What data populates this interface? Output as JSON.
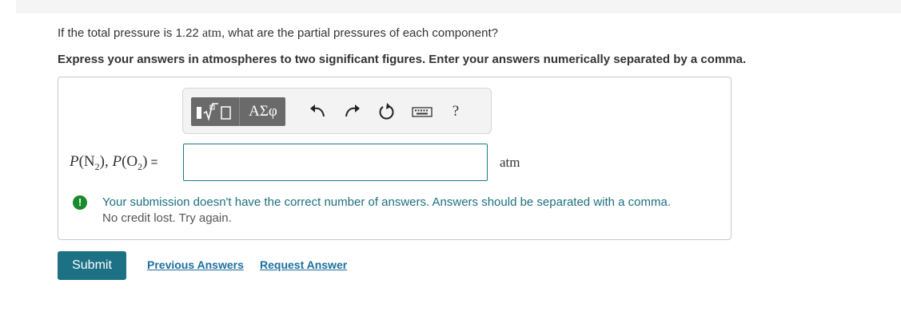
{
  "question": {
    "prefix": "If the total pressure is 1.22 ",
    "math": "atm",
    "suffix": ", what are the partial pressures of each component?"
  },
  "instruction": "Express your answers in atmospheres to two significant figures. Enter your answers numerically separated by a comma.",
  "toolbar": {
    "greek_label": "ΑΣφ",
    "help_label": "?",
    "icons": [
      "templates-radical-icon",
      "greek-symbols-icon",
      "undo-icon",
      "redo-icon",
      "reset-icon",
      "keyboard-icon",
      "help-icon"
    ]
  },
  "answer": {
    "label_p1": "P",
    "label_n": "(N",
    "sub_2a": "2",
    "label_sep": "), ",
    "label_p2": "P",
    "label_o": "(O",
    "sub_2b": "2",
    "label_close": ")",
    "label_eq": " =",
    "input_value": "",
    "input_placeholder": "",
    "unit": "atm"
  },
  "feedback": {
    "icon": "!",
    "line1": "Your submission doesn't have the correct number of answers. Answers should be separated with a comma.",
    "line2": "No credit lost. Try again."
  },
  "actions": {
    "submit_label": "Submit",
    "previous_answers_label": "Previous Answers",
    "request_answer_label": "Request Answer"
  },
  "colors": {
    "accent": "#1d7185",
    "link": "#1d6f9e",
    "feedback_text": "#1d6f7e",
    "feedback_icon": "#1a8a2e",
    "toolbar_group": "#6a6a6a"
  }
}
